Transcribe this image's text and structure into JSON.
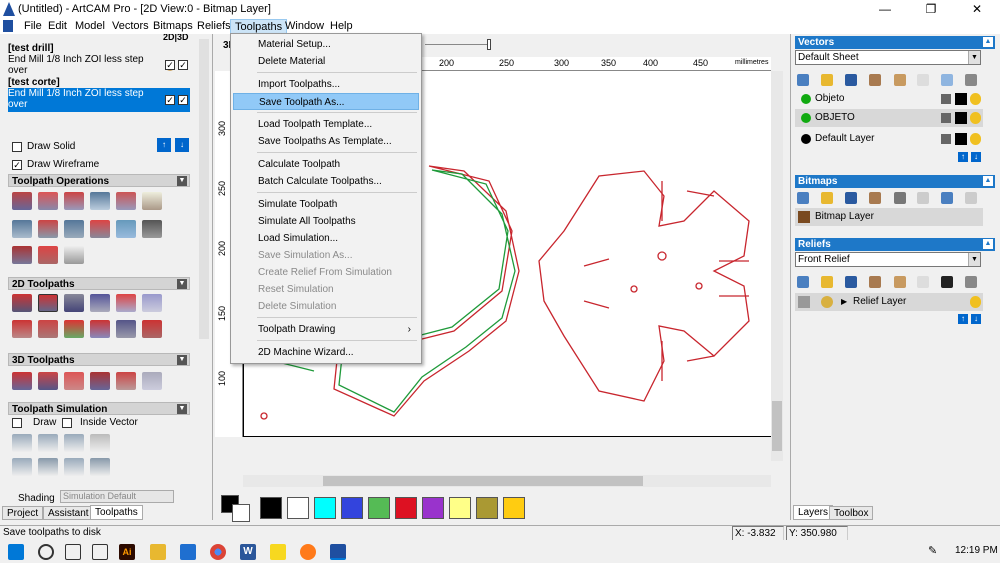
{
  "window": {
    "title": "(Untitled) - ArtCAM Pro - [2D View:0 - Bitmap Layer]",
    "min": "—",
    "max": "❐",
    "close": "✕"
  },
  "menu": [
    "File",
    "Edit",
    "Model",
    "Vectors",
    "Bitmaps",
    "Reliefs",
    "Toolpaths",
    "Window",
    "Help"
  ],
  "view_toggle": "2D|3D",
  "toolpath_list": [
    {
      "group": "[test drill]",
      "item": "End Mill 1/8 Inch ZOI less step over"
    },
    {
      "group": "[test corte]",
      "item": "End Mill 1/8 Inch ZOI less step over"
    }
  ],
  "options": {
    "draw_solid": "Draw Solid",
    "draw_wireframe": "Draw Wireframe"
  },
  "sections": {
    "toolpath_ops": "Toolpath Operations",
    "twod": "2D Toolpaths",
    "threed": "3D Toolpaths",
    "sim": "Toolpath Simulation"
  },
  "sim": {
    "draw": "Draw",
    "inside_vector": "Inside Vector",
    "shading": "Shading",
    "shading_value": "Simulation Default"
  },
  "left_tabs": [
    "Project",
    "Assistant",
    "Toolpaths"
  ],
  "view_label": "3D",
  "ruler": {
    "h": [
      "200",
      "250",
      "300",
      "350",
      "400",
      "450"
    ],
    "units": "millimetres",
    "v": [
      "300",
      "250",
      "200",
      "150",
      "100"
    ]
  },
  "dropdown": [
    {
      "label": "Material Setup...",
      "state": "normal"
    },
    {
      "label": "Delete Material",
      "state": "normal"
    },
    {
      "label": "Import Toolpaths...",
      "state": "normal"
    },
    {
      "label": "Save Toolpath As...",
      "state": "hi"
    },
    {
      "label": "Load Toolpath Template...",
      "state": "normal"
    },
    {
      "label": "Save Toolpaths As Template...",
      "state": "normal"
    },
    {
      "label": "Calculate Toolpath",
      "state": "normal"
    },
    {
      "label": "Batch Calculate Toolpaths...",
      "state": "normal"
    },
    {
      "label": "Simulate Toolpath",
      "state": "normal"
    },
    {
      "label": "Simulate All Toolpaths",
      "state": "normal"
    },
    {
      "label": "Load Simulation...",
      "state": "normal"
    },
    {
      "label": "Save Simulation As...",
      "state": "dis"
    },
    {
      "label": "Create Relief From Simulation",
      "state": "dis"
    },
    {
      "label": "Reset Simulation",
      "state": "dis"
    },
    {
      "label": "Delete Simulation",
      "state": "dis"
    },
    {
      "label": "Toolpath Drawing",
      "state": "normal",
      "submenu": "›"
    },
    {
      "label": "2D Machine Wizard...",
      "state": "normal"
    }
  ],
  "palette": [
    "#000000",
    "#ffffff",
    "#00ffff",
    "#3344dd",
    "#55bb55",
    "#dd1122",
    "#9933cc",
    "#ffff88",
    "#aa9933",
    "#ffcc11"
  ],
  "right": {
    "vectors": "Vectors",
    "vec_sheet": "Default Sheet",
    "layers": [
      "Objeto",
      "OBJETO",
      "Default Layer"
    ],
    "layer_colors": [
      "#11aa11",
      "#11aa11",
      "#000000"
    ],
    "bitmaps": "Bitmaps",
    "bitmap_layer": "Bitmap Layer",
    "reliefs": "Reliefs",
    "relief_sel": "Front Relief",
    "relief_layer": "Relief Layer",
    "tabs": [
      "Layers",
      "Toolbox"
    ]
  },
  "status": {
    "msg": "Save toolpaths to disk",
    "x": "X: -3.832",
    "y": "Y: 350.980"
  },
  "taskbar": {
    "time": "12:19 PM"
  }
}
